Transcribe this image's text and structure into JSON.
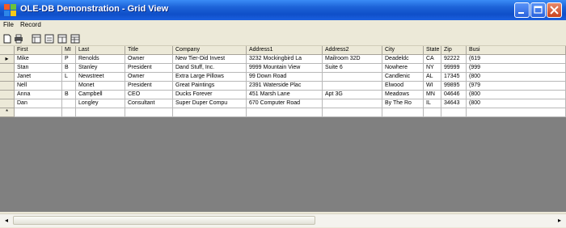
{
  "window": {
    "title": "OLE-DB Demonstration - Grid View"
  },
  "titlebar": {
    "icon": "app-window-icon",
    "controls": [
      "minimize-icon",
      "maximize-icon",
      "close-icon"
    ]
  },
  "menu": {
    "items": [
      "File",
      "Record"
    ]
  },
  "toolbar": {
    "icons": [
      "new-document-icon",
      "print-icon",
      "grid-view-icon",
      "form-view-icon",
      "list-view-icon",
      "table-view-icon"
    ]
  },
  "grid": {
    "columns": [
      "First",
      "MI",
      "Last",
      "Title",
      "Company",
      "Address1",
      "Address2",
      "City",
      "State",
      "Zip",
      "Busi"
    ],
    "rows": [
      [
        "Mike",
        "P",
        "Renolds",
        "Owner",
        "New Tier-Did Invest",
        "3232 Mockingbird La",
        "Mailroom 32D",
        "Deadeldc",
        "CA",
        "92222",
        "(619"
      ],
      [
        "Stan",
        "B",
        "Stanley",
        "President",
        "Dand Stuff, Inc.",
        "9999 Mountain View",
        "Suite 6",
        "Nowhere",
        "NY",
        "99999",
        "(999"
      ],
      [
        "Janet",
        "L",
        "Newstreet",
        "Owner",
        "Extra Large Pillows",
        "99 Down Road",
        "",
        "Candlenic",
        "AL",
        "17345",
        "(800"
      ],
      [
        "Nell",
        "",
        "Monet",
        "President",
        "Great Paintings",
        "2391 Waterside Plac",
        "",
        "Elwood",
        "WI",
        "99895",
        "(979"
      ],
      [
        "Anna",
        "B",
        "Campbell",
        "CEO",
        "Ducks Forever",
        "451 Marsh Lane",
        "Apt 3G",
        "Meadows",
        "MN",
        "04646",
        "(800"
      ],
      [
        "Dan",
        "",
        "Longley",
        "Consultant",
        "Super Duper Compu",
        "670 Computer Road",
        "",
        "By The Ro",
        "IL",
        "34643",
        "(800"
      ]
    ],
    "current_row_marker": "▸",
    "new_row_marker": "*"
  },
  "scrollbar": {
    "left_arrow": "◂",
    "right_arrow": "▸"
  }
}
